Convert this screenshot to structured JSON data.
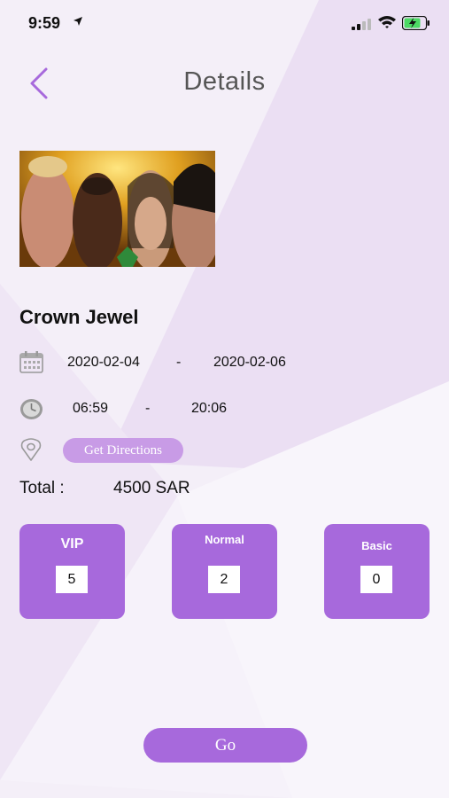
{
  "status_bar": {
    "time": "9:59",
    "icons": [
      "location-arrow-icon",
      "cellular-signal-icon",
      "wifi-icon",
      "battery-charging-icon"
    ]
  },
  "header": {
    "title": "Details",
    "back_icon": "chevron-left-icon"
  },
  "event": {
    "name": "Crown Jewel",
    "start_date": "2020-02-04",
    "date_separator": "-",
    "end_date": "2020-02-06",
    "start_time": "06:59",
    "time_separator": "-",
    "end_time": "20:06",
    "directions_label": "Get Directions"
  },
  "total": {
    "label": "Total :",
    "value": "4500 SAR"
  },
  "tickets": [
    {
      "label": "VIP",
      "quantity": "5"
    },
    {
      "label": "Normal",
      "quantity": "2"
    },
    {
      "label": "Basic",
      "quantity": "0"
    }
  ],
  "go_label": "Go",
  "colors": {
    "accent": "#a769dc",
    "accent_light": "#c89be6",
    "background": "#f3eef7",
    "title_gray": "#555555"
  }
}
